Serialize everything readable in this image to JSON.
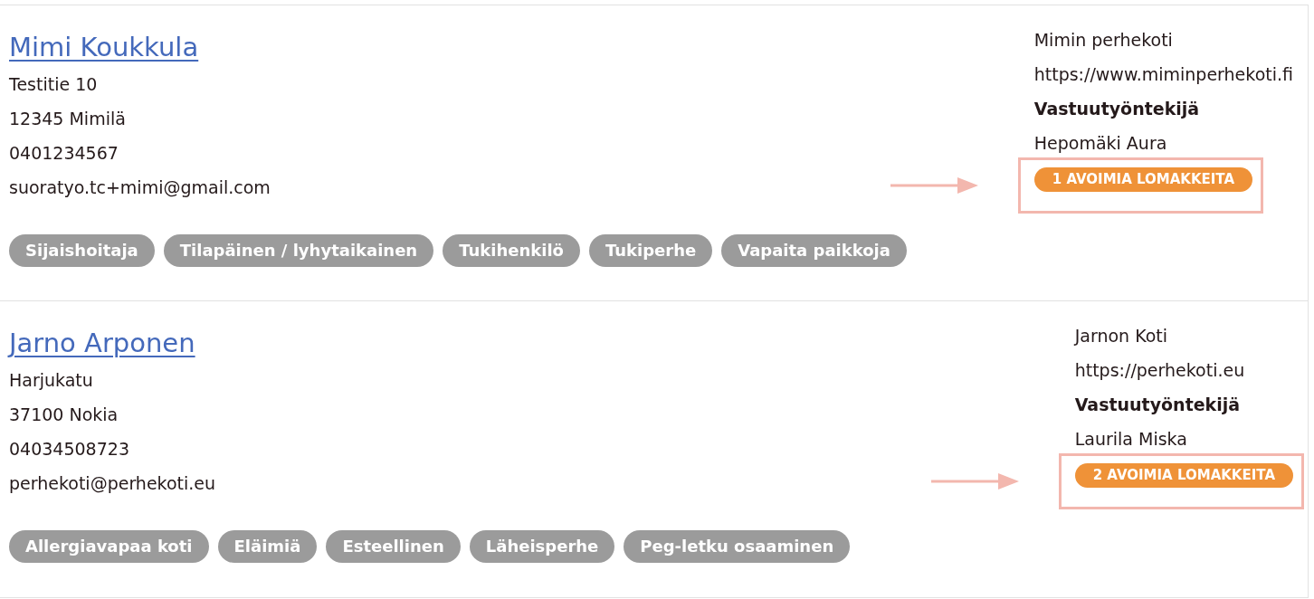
{
  "cards": [
    {
      "name": "Mimi Koukkula",
      "address": "Testitie 10",
      "postal": "12345 Mimilä",
      "phone": "0401234567",
      "email": "suoratyo.tc+mimi@gmail.com",
      "tags": [
        "Sijaishoitaja",
        "Tilapäinen / lyhytaikainen",
        "Tukihenkilö",
        "Tukiperhe",
        "Vapaita paikkoja"
      ],
      "home": "Mimin perhekoti",
      "website": "https://www.miminperhekoti.fi",
      "responsible_label": "Vastuutyöntekijä",
      "responsible_worker": "Hepomäki Aura",
      "open_forms": {
        "label": "1 AVOIMIA LOMAKKEITA",
        "highlighted": true
      }
    },
    {
      "name": "Jarno Arponen",
      "address": "Harjukatu",
      "postal": "37100 Nokia",
      "phone": "04034508723",
      "email": "perhekoti@perhekoti.eu",
      "tags": [
        "Allergiavapaa koti",
        "Eläimiä",
        "Esteellinen",
        "Läheisperhe",
        "Peg-letku osaaminen"
      ],
      "home": "Jarnon Koti",
      "website": "https://perhekoti.eu",
      "responsible_label": "Vastuutyöntekijä",
      "responsible_worker": "Laurila Miska",
      "open_forms": {
        "label": "2 AVOIMIA LOMAKKEITA",
        "highlighted": true
      }
    }
  ]
}
